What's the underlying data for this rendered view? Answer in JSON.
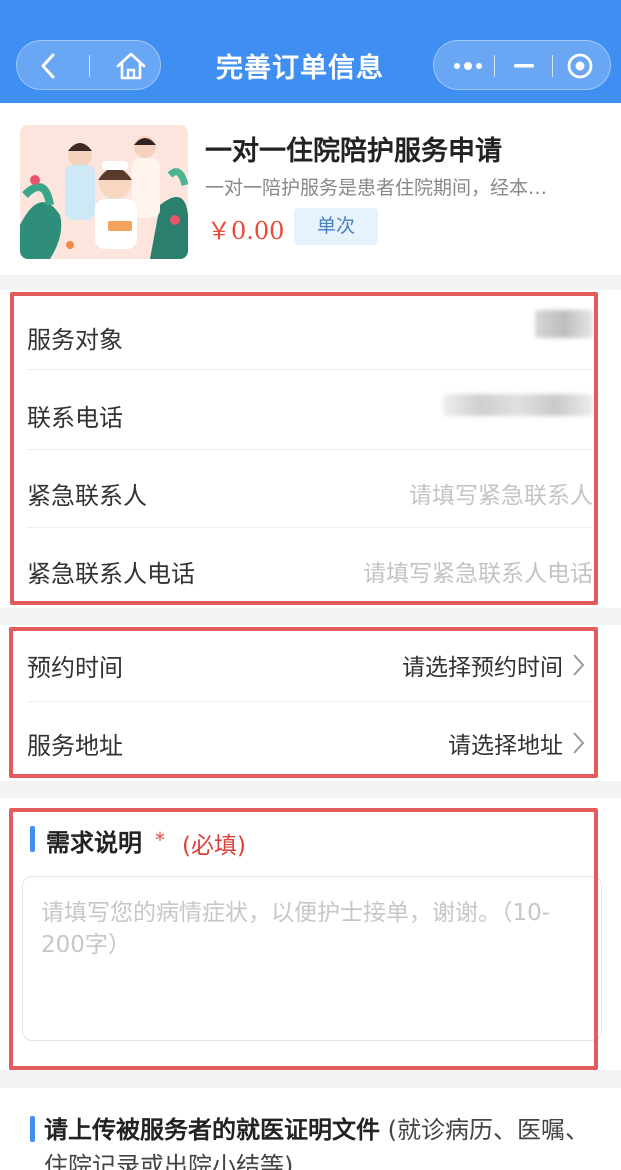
{
  "header": {
    "title": "完善订单信息",
    "back_icon": "back-icon",
    "home_icon": "home-icon",
    "more_icon": "more-icon",
    "minimize_icon": "minimize-icon",
    "close_icon": "target-icon",
    "color": "#3f8ff3"
  },
  "product": {
    "title": "一对一住院陪护服务申请",
    "description": "一对一陪护服务是患者住院期间，经本…",
    "price": "￥0.00",
    "badge": "单次"
  },
  "contact": {
    "rows": [
      {
        "label": "服务对象",
        "value": ""
      },
      {
        "label": "联系电话",
        "value": ""
      },
      {
        "label": "紧急联系人",
        "placeholder": "请填写紧急联系人"
      },
      {
        "label": "紧急联系人电话",
        "placeholder": "请填写紧急联系人电话"
      }
    ]
  },
  "booking": {
    "rows": [
      {
        "label": "预约时间",
        "value": "请选择预约时间"
      },
      {
        "label": "服务地址",
        "value": "请选择地址"
      }
    ]
  },
  "requirement": {
    "title": "需求说明",
    "star": "*",
    "required": "(必填)",
    "placeholder": "请填写您的病情症状，以便护士接单，谢谢。（10-200字）"
  },
  "upload": {
    "title": "请上传被服务者的就医证明文件",
    "note": "(就诊病历、医嘱、住院记录或出院小结等)"
  },
  "colors": {
    "accent": "#3f8ff3",
    "price": "#e84a3b",
    "highlight_border": "#e45b5b"
  }
}
